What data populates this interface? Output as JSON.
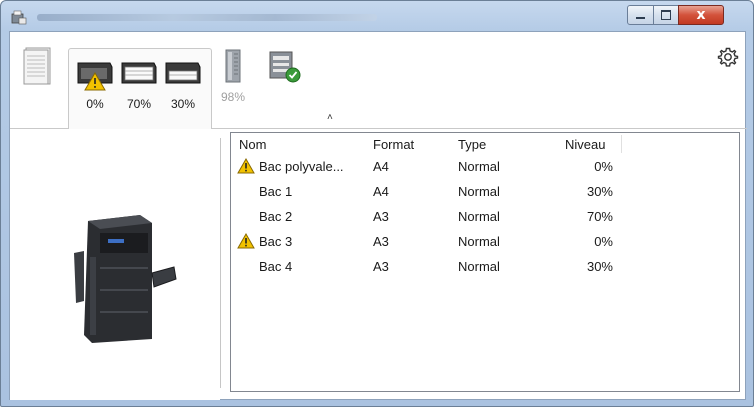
{
  "window": {
    "close_glyph": "x",
    "min_glyph": "–",
    "max_glyph": "□",
    "app_icon": "printer-status-icon"
  },
  "toolbar": {
    "tools": [
      {
        "name": "paper-stack-icon",
        "pct": ""
      },
      {
        "name": "tray-1-icon",
        "pct": "0%",
        "warning": true
      },
      {
        "name": "tray-2-icon",
        "pct": "70%"
      },
      {
        "name": "tray-3-icon",
        "pct": "30%"
      },
      {
        "name": "toner-icon",
        "pct": "98%"
      },
      {
        "name": "printer-ready-icon",
        "pct": ""
      }
    ],
    "collapse_glyph": "˄",
    "settings_icon": "gear-icon"
  },
  "list": {
    "headers": [
      "Nom",
      "Format",
      "Type",
      "Niveau"
    ],
    "rows": [
      {
        "nom": "Bac polyvale...",
        "format": "A4",
        "type": "Normal",
        "niveau": "0%",
        "warning": true
      },
      {
        "nom": "Bac 1",
        "format": "A4",
        "type": "Normal",
        "niveau": "30%",
        "warning": false
      },
      {
        "nom": "Bac 2",
        "format": "A3",
        "type": "Normal",
        "niveau": "70%",
        "warning": false
      },
      {
        "nom": "Bac 3",
        "format": "A3",
        "type": "Normal",
        "niveau": "0%",
        "warning": true
      },
      {
        "nom": "Bac 4",
        "format": "A3",
        "type": "Normal",
        "niveau": "30%",
        "warning": false
      }
    ]
  },
  "colors": {
    "warning_fill": "#f2c200",
    "warning_stroke": "#8a6a00",
    "ready_check": "#3a9a3a"
  }
}
